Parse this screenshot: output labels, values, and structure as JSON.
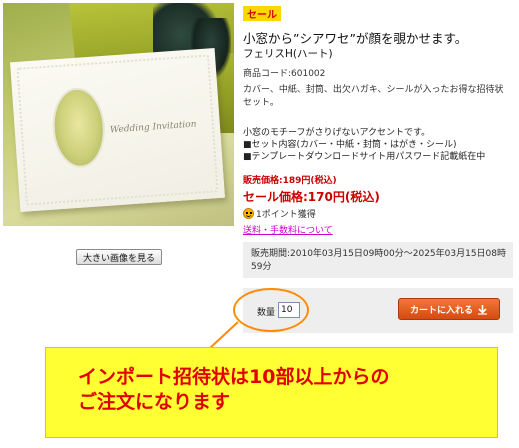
{
  "product_image": {
    "card_caption": "Wedding Invitation"
  },
  "buttons": {
    "big_image": "大きい画像を見る",
    "add_to_cart": "カートに入れる"
  },
  "sale_badge": "セール",
  "catch_copy": "小窓から”シアワセ”が顔を覗かせます。",
  "product_name": "フェリスH(ハート)",
  "product_code": "商品コード:601002",
  "description": "カバー、中紙、封筒、出欠ハガキ、シールが入ったお得な招待状セット。",
  "details": [
    "小窓のモチーフがさりげないアクセントです。",
    "■セット内容(カバー・中紙・封筒・はがき・シール)",
    "■テンプレートダウンロードサイト用パスワード記載紙在中"
  ],
  "price": {
    "regular": "販売価格:189円(税込)",
    "sale": "セール価格:170円(税込)",
    "points": "1ポイント獲得"
  },
  "fee_link": "送料・手数料について",
  "sale_period": "販売期間:2010年03月15日09時00分～2025年03月15日08時59分",
  "cart": {
    "qty_label": "数量",
    "qty_value": "10"
  },
  "notice": {
    "line1": "インポート招待状は10部以上からの",
    "line2": "ご注文になります"
  },
  "colors": {
    "accent_red": "#cc0000",
    "notice_bg": "#ffff33",
    "callout": "#ff8c00",
    "cart_button": "#e05a20"
  }
}
